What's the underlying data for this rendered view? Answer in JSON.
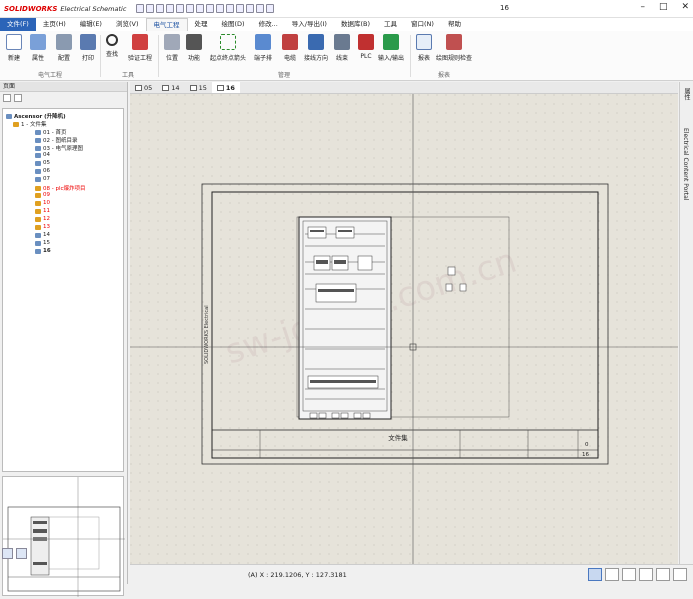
{
  "app": {
    "logo": "SOLIDWORKS",
    "product": "Electrical Schematic",
    "window_title": "16"
  },
  "menu": [
    "文件(F)",
    "主页(H)",
    "编辑(E)",
    "浏览(V)",
    "电气工程",
    "处理",
    "绘图(D)",
    "修改...",
    "导入/导出(I)",
    "数据库(B)",
    "工具",
    "窗口(N)",
    "帮助"
  ],
  "ribbon": {
    "buttons": [
      "新建",
      "属性",
      "配置",
      "打印",
      "查找",
      "验证工程",
      "位置",
      "功能",
      "起点终点箭头",
      "端子排",
      "电缆",
      "接线方向",
      "线束",
      "PLC",
      "输入/输出",
      "报表",
      "绘图规则检查"
    ],
    "groups": [
      "电气工程",
      "工具",
      "管理",
      "报表"
    ]
  },
  "left_pane": {
    "title": "页面",
    "project": "Ascensor (升降机)",
    "folder": "1 - 文件集",
    "pages": [
      {
        "label": "01 - 首页",
        "red": false
      },
      {
        "label": "02 - 图纸目录",
        "red": false
      },
      {
        "label": "03 - 电气原理图",
        "red": false
      },
      {
        "label": "04",
        "red": false
      },
      {
        "label": "05",
        "red": false
      },
      {
        "label": "06",
        "red": false
      },
      {
        "label": "07",
        "red": false
      },
      {
        "label": "08 - plc爆炸项目",
        "red": true
      },
      {
        "label": "09",
        "red": true
      },
      {
        "label": "10",
        "red": true
      },
      {
        "label": "11",
        "red": true
      },
      {
        "label": "12",
        "red": true
      },
      {
        "label": "13",
        "red": true
      },
      {
        "label": "14",
        "red": false
      },
      {
        "label": "15",
        "red": false
      },
      {
        "label": "16",
        "red": false
      }
    ]
  },
  "tabs": [
    "05",
    "14",
    "15",
    "16"
  ],
  "drawing": {
    "title_block_text": "文件集",
    "side_text": "SOLIDWORKS Electrical",
    "sheet_no": "16",
    "sheet_count": "0",
    "watermark": "sw-joysun.com.cn"
  },
  "right_bar": [
    "属性",
    "Electrical Content Portal"
  ],
  "status": {
    "coords": "(A) X : 219.1206, Y : 127.3181"
  }
}
